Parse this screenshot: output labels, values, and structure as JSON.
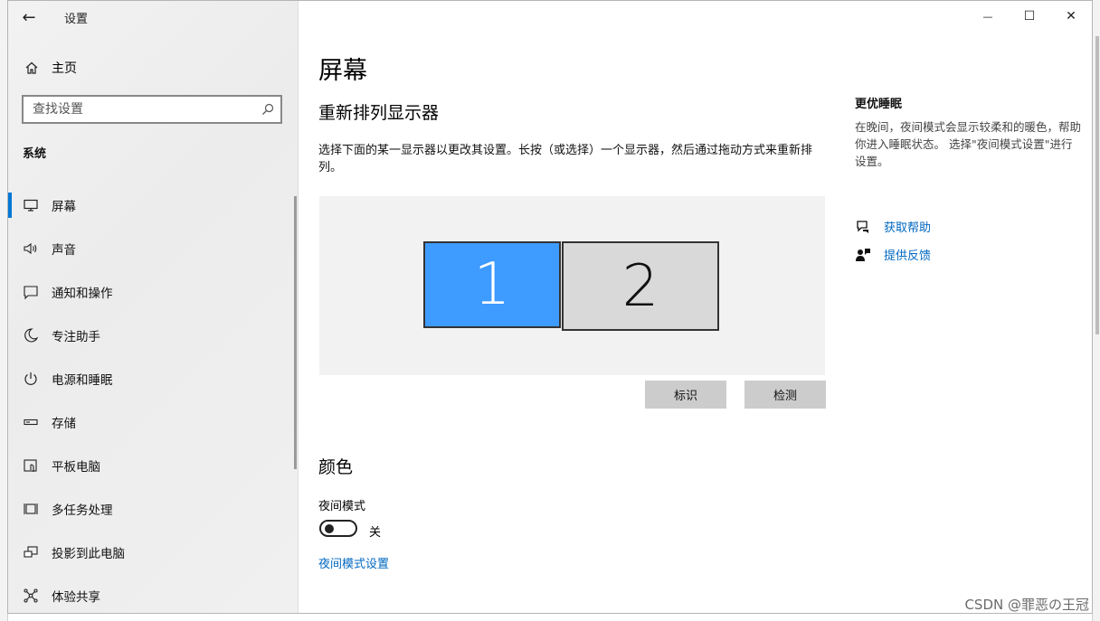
{
  "window": {
    "title": "设置",
    "back_glyph": "←",
    "minimize_glyph": "—",
    "maximize_glyph": "☐",
    "close_glyph": "✕"
  },
  "sidebar": {
    "home_label": "主页",
    "search_placeholder": "查找设置",
    "section_label": "系统",
    "items": [
      {
        "label": "屏幕",
        "icon": "monitor-icon",
        "selected": true
      },
      {
        "label": "声音",
        "icon": "speaker-icon"
      },
      {
        "label": "通知和操作",
        "icon": "message-icon"
      },
      {
        "label": "专注助手",
        "icon": "moon-icon"
      },
      {
        "label": "电源和睡眠",
        "icon": "power-icon"
      },
      {
        "label": "存储",
        "icon": "storage-icon"
      },
      {
        "label": "平板电脑",
        "icon": "tablet-icon"
      },
      {
        "label": "多任务处理",
        "icon": "multitask-icon"
      },
      {
        "label": "投影到此电脑",
        "icon": "project-icon"
      },
      {
        "label": "体验共享",
        "icon": "share-icon"
      }
    ]
  },
  "main": {
    "page_title": "屏幕",
    "arrange_title": "重新排列显示器",
    "arrange_desc": "选择下面的某一显示器以更改其设置。长按（或选择）一个显示器，然后通过拖动方式来重新排列。",
    "monitors": [
      {
        "label": "1",
        "selected": true
      },
      {
        "label": "2",
        "selected": false
      }
    ],
    "identify_label": "标识",
    "detect_label": "检测",
    "color_title": "颜色",
    "night_mode_label": "夜间模式",
    "night_mode_state": "关",
    "night_mode_settings_link": "夜间模式设置"
  },
  "aside": {
    "title": "更优睡眠",
    "text": "在晚间，夜间模式会显示较柔和的暖色，帮助你进入睡眠状态。 选择\"夜间模式设置\"进行设置。",
    "get_help": "获取帮助",
    "feedback": "提供反馈"
  },
  "watermark": "CSDN @罪恶の王冠",
  "colors": {
    "accent": "#0078d7",
    "link": "#0067c0",
    "monitor_selected": "#3e9bff",
    "monitor_other": "#d9d9d9"
  }
}
